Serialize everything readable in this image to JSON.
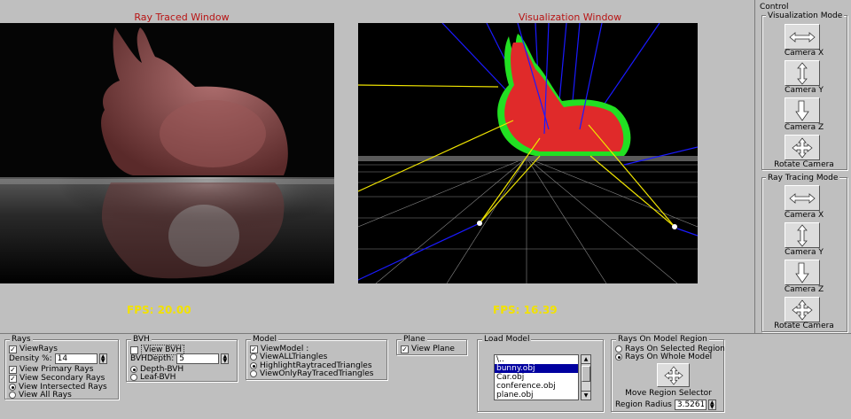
{
  "ray_traced_window": {
    "title": "Ray Traced Window",
    "fps": "FPS: 20.00"
  },
  "visualization_window": {
    "title": "Visualization Window",
    "fps": "FPS: 16.39"
  },
  "control": {
    "title": "Control",
    "visualization_mode": {
      "title": "Visualization Mode",
      "buttons": [
        {
          "label": "Camera X",
          "icon": "horizontal-arrows-icon"
        },
        {
          "label": "Camera Y",
          "icon": "vertical-arrows-icon"
        },
        {
          "label": "Camera Z",
          "icon": "diagonal-arrow-icon"
        },
        {
          "label": "Rotate Camera",
          "icon": "four-way-arrows-icon"
        }
      ]
    },
    "ray_tracing_mode": {
      "title": "Ray Tracing Mode",
      "buttons": [
        {
          "label": "Camera X",
          "icon": "horizontal-arrows-icon"
        },
        {
          "label": "Camera Y",
          "icon": "vertical-arrows-icon"
        },
        {
          "label": "Camera Z",
          "icon": "diagonal-arrow-icon"
        },
        {
          "label": "Rotate Camera",
          "icon": "four-way-arrows-icon"
        }
      ]
    }
  },
  "rays": {
    "title": "Rays",
    "view_rays": "ViewRays",
    "density_label": "Density %:",
    "density_value": "14",
    "view_primary": "View Primary Rays",
    "view_secondary": "View Secondary Rays",
    "view_intersected": "View Intersected Rays",
    "view_all": "View All Rays"
  },
  "bvh": {
    "title": "BVH",
    "view_bvh": "View BVH",
    "depth_label": "BVHDepth:",
    "depth_value": "5",
    "depth_bvh": "Depth-BVH",
    "leaf_bvh": "Leaf-BVH"
  },
  "model": {
    "title": "Model",
    "view_model": "ViewModel :",
    "view_all_triangles": "ViewALLTriangles",
    "highlight": "HighlightRaytracedTriangles",
    "view_only": "ViewOnlyRayTracedTriangles"
  },
  "plane": {
    "title": "Plane",
    "view_plane": "View Plane"
  },
  "load_model": {
    "title": "Load Model",
    "items": [
      "\\..",
      "bunny.obj",
      "Car.obj",
      "conference.obj",
      "plane.obj"
    ],
    "selected_index": 1
  },
  "rays_on_model_region": {
    "title": "Rays On Model Region",
    "selected_region": "Rays On Selected Region",
    "whole_model": "Rays On Whole Model",
    "move_selector": "Move Region Selector",
    "radius_label": "Region Radius",
    "radius_value": "3.5261"
  }
}
